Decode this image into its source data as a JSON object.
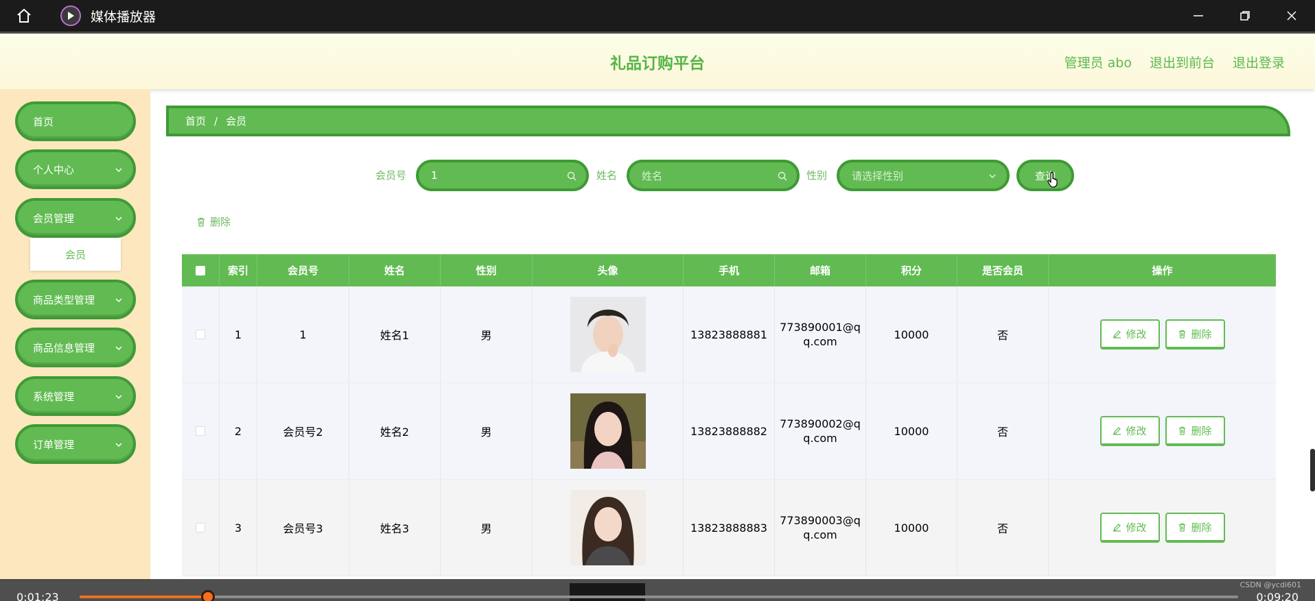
{
  "player": {
    "app_title": "媒体播放器",
    "time_current": "0:01:23",
    "time_total": "0:09:20",
    "progress": 0.111,
    "watermark": "CSDN @ycdi601"
  },
  "header": {
    "brand": "礼品订购平台",
    "admin": "管理员 abo",
    "front": "退出到前台",
    "logout": "退出登录"
  },
  "sidebar": {
    "items": [
      {
        "label": "首页"
      },
      {
        "label": "个人中心"
      },
      {
        "label": "会员管理"
      },
      {
        "label": "商品类型管理"
      },
      {
        "label": "商品信息管理"
      },
      {
        "label": "系统管理"
      },
      {
        "label": "订单管理"
      }
    ],
    "submenu": "会员"
  },
  "breadcrumb": {
    "home": "首页",
    "sep": "/",
    "current": "会员"
  },
  "search": {
    "member_label": "会员号",
    "member_value": "1",
    "name_label": "姓名",
    "name_placeholder": "姓名",
    "gender_label": "性别",
    "gender_placeholder": "请选择性别",
    "query_label": "查询"
  },
  "actions": {
    "delete": "删除"
  },
  "table": {
    "headers": [
      "索引",
      "会员号",
      "姓名",
      "性别",
      "头像",
      "手机",
      "邮箱",
      "积分",
      "是否会员",
      "操作"
    ],
    "edit_label": "修改",
    "delete_label": "删除",
    "rows": [
      {
        "index": "1",
        "member": "1",
        "name": "姓名1",
        "gender": "男",
        "phone": "13823888881",
        "email1": "773890001@q",
        "email2": "q.com",
        "points": "10000",
        "vip": "否"
      },
      {
        "index": "2",
        "member": "会员号2",
        "name": "姓名2",
        "gender": "男",
        "phone": "13823888882",
        "email1": "773890002@q",
        "email2": "q.com",
        "points": "10000",
        "vip": "否"
      },
      {
        "index": "3",
        "member": "会员号3",
        "name": "姓名3",
        "gender": "男",
        "phone": "13823888883",
        "email1": "773890003@q",
        "email2": "q.com",
        "points": "10000",
        "vip": "否"
      }
    ]
  },
  "colors": {
    "primary": "#61bb52",
    "primary_dark": "#3f9a35",
    "sidebar_bg": "#fde7bf",
    "progress": "#f07020"
  }
}
